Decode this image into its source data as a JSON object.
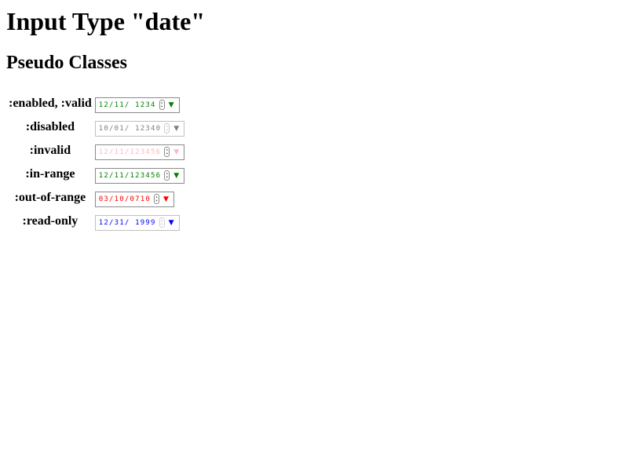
{
  "page": {
    "title": "Input Type \"date\"",
    "subtitle": "Pseudo Classes"
  },
  "rows": [
    {
      "label": ":enabled, :valid",
      "value": "12/11/ 1234",
      "color": "#008000",
      "state": "enabled-valid"
    },
    {
      "label": ":disabled",
      "value": "10/01/ 12340",
      "color": "#808080",
      "state": "disabled"
    },
    {
      "label": ":invalid",
      "value": "12/11/123456",
      "color": "#ffb6c1",
      "state": "invalid"
    },
    {
      "label": ":in-range",
      "value": "12/11/123456",
      "color": "#008000",
      "state": "in-range"
    },
    {
      "label": ":out-of-range",
      "value": "03/10/0710",
      "color": "#ff0000",
      "state": "out-of-range"
    },
    {
      "label": ":read-only",
      "value": "12/31/ 1999",
      "color": "#0000ff",
      "state": "read-only"
    }
  ],
  "icons": {
    "spinner": "spin-up-down-icon",
    "dropdown": "triangle-down-icon"
  }
}
